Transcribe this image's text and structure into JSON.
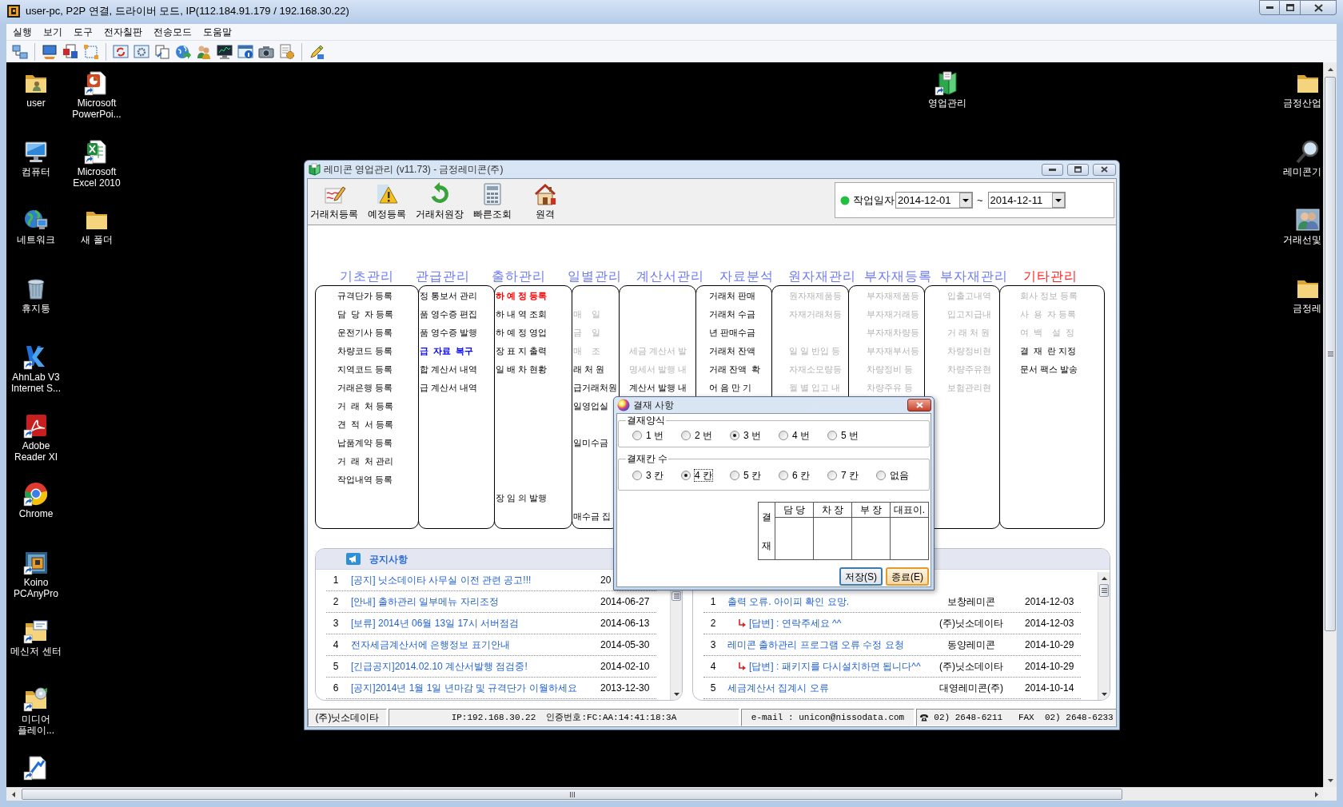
{
  "viewer": {
    "title": "user-pc, P2P 연결, 드라이버 모드, IP(112.184.91.179 / 192.168.30.22)",
    "menu": [
      "실행",
      "보기",
      "도구",
      "전자칠판",
      "전송모드",
      "도움말"
    ]
  },
  "desktop": {
    "icon_columns": [
      [
        {
          "kind": "user_folder",
          "label": "user"
        },
        {
          "kind": "computer",
          "label": "컴퓨터"
        },
        {
          "kind": "network",
          "label": "네트워크"
        },
        {
          "kind": "trash",
          "label": "휴지통"
        },
        {
          "kind": "v_logo",
          "label": "AhnLab V3 Internet S..."
        },
        {
          "kind": "document",
          "label": "Adobe Reader XI"
        },
        {
          "kind": "round_logo",
          "label": "Chrome"
        },
        {
          "kind": "square_logo",
          "label": "Koino PCAnyPro"
        },
        {
          "kind": "folder_card",
          "label": "메신저 센터"
        },
        {
          "kind": "folder_disc",
          "label": "미디어 플레이..."
        },
        {
          "kind": "shortcut"
        }
      ],
      [
        {
          "kind": "presentation",
          "label": "Microsoft PowerPoi..."
        },
        {
          "kind": "spreadsheet",
          "label": "Microsoft Excel 2010"
        },
        {
          "kind": "folder",
          "label": "새 폴더"
        }
      ]
    ],
    "top_icons": [
      {
        "kind": "book",
        "label": "영업관리"
      }
    ],
    "right_icons": [
      {
        "kind": "folder",
        "label": "금정산업"
      },
      {
        "kind": "magnifier",
        "label": "레미콘기"
      },
      {
        "kind": "people",
        "label": "거래선및"
      },
      {
        "kind": "folder",
        "label": "금정레"
      }
    ]
  },
  "app_window": {
    "title": "레미콘 영업관리 (v11.73) - 금정레미콘(주)",
    "toolbar": [
      {
        "kind": "register",
        "label": "거래처등록"
      },
      {
        "kind": "schedule",
        "label": "예정등록"
      },
      {
        "kind": "ledger",
        "label": "거래처원장"
      },
      {
        "kind": "lookup",
        "label": "빠른조회"
      },
      {
        "kind": "remote",
        "label": "원격"
      }
    ],
    "work_date": {
      "label": "작업일자",
      "from": "2014-12-01",
      "separator": "~",
      "to": "2014-12-11"
    },
    "menu_columns": [
      {
        "title": "기초관리",
        "color": "#6b78f2",
        "items": [
          {
            "kind": "entry",
            "label": "규격단가 등록",
            "disabled": false
          },
          {
            "kind": "entry",
            "label": "담  당  자 등록",
            "disabled": false
          },
          {
            "kind": "entry",
            "label": "운전기사 등록",
            "disabled": false
          },
          {
            "kind": "entry",
            "label": "차량코드 등록",
            "disabled": false
          },
          {
            "kind": "entry",
            "label": "지역코드 등록",
            "disabled": false
          },
          {
            "kind": "entry",
            "label": "거래은행 등록",
            "disabled": false
          },
          {
            "kind": "entry",
            "label": "거  래  처 등록",
            "disabled": false
          },
          {
            "kind": "entry",
            "label": "견  적  서 등록",
            "disabled": false
          },
          {
            "kind": "entry",
            "label": "납품계약 등록",
            "disabled": false
          },
          {
            "kind": "entry",
            "label": "거  래  처 관리",
            "disabled": false
          },
          {
            "kind": "entry",
            "label": "작업내역 등록",
            "disabled": false
          }
        ]
      },
      {
        "title": "관급관리",
        "color": "#6b78f2",
        "items": [
          {
            "kind": "entry",
            "label": "정 통보서 관리",
            "disabled": false
          },
          {
            "kind": "entry",
            "label": "품 영수증 편집",
            "disabled": false
          },
          {
            "kind": "entry",
            "label": "품 영수증 발행",
            "disabled": false
          },
          {
            "kind": "entry",
            "label": "급  자료  복구",
            "disabled": false,
            "color": "#0000ff"
          },
          {
            "kind": "entry",
            "label": "합 계산서 내역",
            "disabled": false
          },
          {
            "kind": "entry",
            "label": "급 계산서 내역",
            "disabled": false
          }
        ]
      },
      {
        "title": "출하관리",
        "color": "#6b78f2",
        "items": [
          {
            "kind": "entry",
            "label": "하 예 정 등록",
            "disabled": false,
            "color": "#ff0000"
          },
          {
            "kind": "entry",
            "label": "하 내 역 조회",
            "disabled": false
          },
          {
            "kind": "entry",
            "label": "하 예 정 영업",
            "disabled": false
          },
          {
            "kind": "entry",
            "label": "장 표 지 출력",
            "disabled": false
          },
          {
            "kind": "entry",
            "label": "일 배 차 현황",
            "disabled": false
          },
          {
            "kind": "spacer"
          },
          {
            "kind": "spacer"
          },
          {
            "kind": "spacer"
          },
          {
            "kind": "spacer"
          },
          {
            "kind": "spacer"
          },
          {
            "kind": "spacer"
          },
          {
            "kind": "entry",
            "label": "장 임 의 발행",
            "disabled": false
          }
        ]
      },
      {
        "title": "일별관리",
        "color": "#6b78f2",
        "items": [
          {
            "kind": "spacer"
          },
          {
            "kind": "entry",
            "label": "매    일",
            "disabled": true
          },
          {
            "kind": "entry",
            "label": "금    일",
            "disabled": true
          },
          {
            "kind": "entry",
            "label": "매    조",
            "disabled": true
          },
          {
            "kind": "entry",
            "label": "래 처 원",
            "disabled": false
          },
          {
            "kind": "entry",
            "label": "급거래처원",
            "disabled": false
          },
          {
            "kind": "entry",
            "label": "일영업실",
            "disabled": false
          },
          {
            "kind": "spacer"
          },
          {
            "kind": "entry",
            "label": "일미수금",
            "disabled": false
          },
          {
            "kind": "spacer"
          },
          {
            "kind": "spacer"
          },
          {
            "kind": "spacer"
          },
          {
            "kind": "entry",
            "label": "매수금 집",
            "disabled": false
          }
        ]
      },
      {
        "title": "계산서관리",
        "color": "#6b78f2",
        "items": [
          {
            "kind": "spacer"
          },
          {
            "kind": "spacer"
          },
          {
            "kind": "spacer"
          },
          {
            "kind": "entry",
            "label": "세금 계산서 발",
            "disabled": true
          },
          {
            "kind": "entry",
            "label": "명세서 발행 내",
            "disabled": true
          },
          {
            "kind": "entry",
            "label": "계산서 발행 내",
            "disabled": false
          }
        ]
      },
      {
        "title": "자료분석",
        "color": "#6b78f2",
        "items": [
          {
            "kind": "entry",
            "label": "거래처 판매",
            "disabled": false
          },
          {
            "kind": "entry",
            "label": "거래처 수금",
            "disabled": false
          },
          {
            "kind": "entry",
            "label": "년 판매수금",
            "disabled": false
          },
          {
            "kind": "entry",
            "label": "거래처 잔액",
            "disabled": false
          },
          {
            "kind": "entry",
            "label": "거래 잔액  확",
            "disabled": false
          },
          {
            "kind": "entry",
            "label": "어 음 만 기",
            "disabled": false
          }
        ]
      },
      {
        "title": "원자재관리",
        "color": "#6b78f2",
        "items": [
          {
            "kind": "entry",
            "label": "원자재제품등",
            "disabled": true
          },
          {
            "kind": "entry",
            "label": "자재거래처등",
            "disabled": true
          },
          {
            "kind": "spacer"
          },
          {
            "kind": "entry",
            "label": "일 일 반입 등",
            "disabled": true
          },
          {
            "kind": "entry",
            "label": "자재소모량등",
            "disabled": true
          },
          {
            "kind": "entry",
            "label": "월 별 입고 내",
            "disabled": true
          }
        ]
      },
      {
        "title": "부자재등록",
        "color": "#6b78f2",
        "items": [
          {
            "kind": "entry",
            "label": "부자재제품등",
            "disabled": true
          },
          {
            "kind": "entry",
            "label": "부자재거래등",
            "disabled": true
          },
          {
            "kind": "entry",
            "label": "부자재차량등",
            "disabled": true
          },
          {
            "kind": "entry",
            "label": "부자재부서등",
            "disabled": true
          },
          {
            "kind": "entry",
            "label": "차량정비 등",
            "disabled": true
          },
          {
            "kind": "entry",
            "label": "차량주유 등",
            "disabled": true
          }
        ]
      },
      {
        "title": "부자재관리",
        "color": "#6b78f2",
        "items": [
          {
            "kind": "entry",
            "label": "입출고내역",
            "disabled": true
          },
          {
            "kind": "entry",
            "label": "입고지급내",
            "disabled": true
          },
          {
            "kind": "entry",
            "label": "거 래 처 원",
            "disabled": true
          },
          {
            "kind": "entry",
            "label": "차량정비현",
            "disabled": true
          },
          {
            "kind": "entry",
            "label": "차량주유현",
            "disabled": true
          },
          {
            "kind": "entry",
            "label": "보험관리현",
            "disabled": true
          }
        ]
      },
      {
        "title": "기타관리",
        "color": "#ff2020",
        "items": [
          {
            "kind": "entry",
            "label": "회사 정보 등록",
            "disabled": true
          },
          {
            "kind": "entry",
            "label": "사  용  자 등록",
            "disabled": true
          },
          {
            "kind": "entry",
            "label": "여  백    설  정",
            "disabled": true
          },
          {
            "kind": "entry",
            "label": "결  재  란 지정",
            "disabled": false
          },
          {
            "kind": "entry",
            "label": "문서 팩스 발송",
            "disabled": false
          }
        ]
      }
    ],
    "notices": {
      "title": "공지사항",
      "rows": [
        {
          "no": "1",
          "title": "[공지] 닛소데이타 사무실 이전 관련 공고!!!",
          "date": "20"
        },
        {
          "no": "2",
          "title": "[안내] 출하관리 일부메뉴 자리조정",
          "date": "2014-06-27"
        },
        {
          "no": "3",
          "title": "[보류] 2014년 06월 13일 17시 서버점검",
          "date": "2014-06-13"
        },
        {
          "no": "4",
          "title": "전자세금계산서에 은행정보 표기안내",
          "date": "2014-05-30"
        },
        {
          "no": "5",
          "title": "[긴급공지]2014.02.10 계산서발행 점검중!",
          "date": "2014-02-10"
        },
        {
          "no": "6",
          "title": "[공지]2014년 1월 1일 년마감 및 규격단가 이월하세요",
          "date": "2013-12-30"
        }
      ]
    },
    "board": {
      "rows": [
        {
          "no": "1",
          "reply": false,
          "title": "출력 오류. 아이피 확인 요망.",
          "author": "보창레미콘",
          "date": "2014-12-03"
        },
        {
          "no": "2",
          "reply": true,
          "title": "[답변] : 연락주세요 ^^",
          "author": "(주)닛소데이타",
          "date": "2014-12-03"
        },
        {
          "no": "3",
          "reply": false,
          "title": "레미콘 출하관리 프로그램 오류 수정 요청",
          "author": "동양레미콘",
          "date": "2014-10-29"
        },
        {
          "no": "4",
          "reply": true,
          "title": "[답변] : 패키지를 다시설치하면 됩니다^^",
          "author": "(주)닛소데이타",
          "date": "2014-10-29"
        },
        {
          "no": "5",
          "reply": false,
          "title": "세금계산서 집계시 오류",
          "author": "대영레미콘(주)",
          "date": "2014-10-14"
        }
      ]
    },
    "status_bar": [
      {
        "kind": "plain",
        "text": "(주)닛소데이타"
      },
      {
        "kind": "mono",
        "text": "IP:192.168.30.22  인증번호:FC:AA:14:41:18:3A"
      },
      {
        "kind": "mono",
        "text": "e-mail : unicon@nissodata.com"
      },
      {
        "kind": "phone",
        "text": "02) 2648-6211   FAX  02) 2648-6233"
      }
    ]
  },
  "dialog": {
    "title": "결재 사항",
    "groups": [
      {
        "label": "결재양식",
        "options": [
          {
            "label": "1 번",
            "selected": false,
            "focused": false
          },
          {
            "label": "2 번",
            "selected": false,
            "focused": false
          },
          {
            "label": "3 번",
            "selected": true,
            "focused": false
          },
          {
            "label": "4 번",
            "selected": false,
            "focused": false
          },
          {
            "label": "5 번",
            "selected": false,
            "focused": false
          }
        ]
      },
      {
        "label": "결재칸 수",
        "options": [
          {
            "label": "3 칸",
            "selected": false,
            "focused": false
          },
          {
            "label": "4 칸",
            "selected": true,
            "focused": true
          },
          {
            "label": "5 칸",
            "selected": false,
            "focused": false
          },
          {
            "label": "6 칸",
            "selected": false,
            "focused": false
          },
          {
            "label": "7 칸",
            "selected": false,
            "focused": false
          },
          {
            "label": "없음",
            "selected": false,
            "focused": false
          }
        ]
      }
    ],
    "approval_table": {
      "side_label": "결재",
      "columns": [
        "담 당",
        "차 장",
        "부 장",
        "대표이."
      ]
    },
    "buttons": [
      {
        "label": "저장(S)",
        "focused": false
      },
      {
        "label": "종료(E)",
        "focused": true
      }
    ]
  }
}
